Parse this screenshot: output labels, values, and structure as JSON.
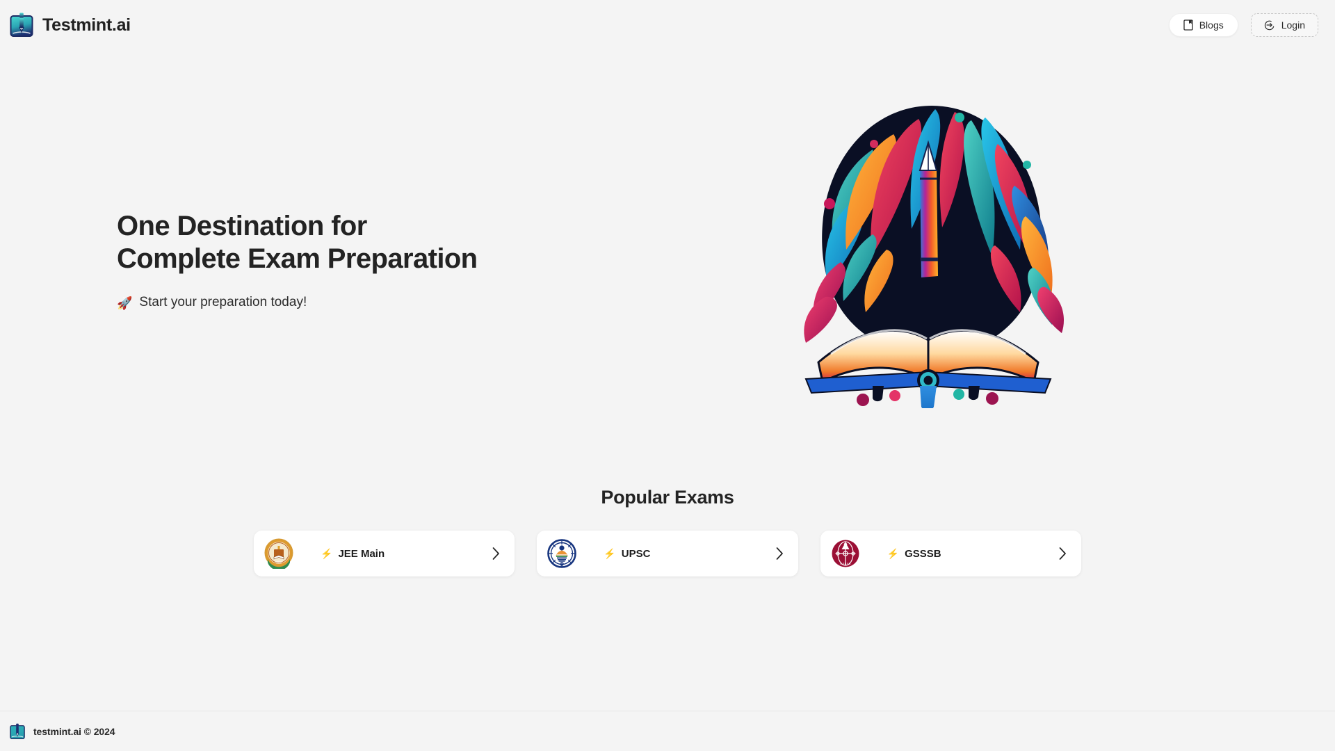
{
  "theme": {
    "background": "#f4f4f4",
    "card_background": "#ffffff",
    "text_primary": "#232323",
    "logo_gradient_from": "#3fd3cf",
    "logo_gradient_to": "#1b2b6b"
  },
  "header": {
    "brand_name": "Testmint.ai",
    "brand_logo_icon": "book-pen-icon",
    "blogs_button": {
      "label": "Blogs",
      "icon": "document-bookmark-icon"
    },
    "login_button": {
      "label": "Login",
      "icon": "login-arrow-circle-icon"
    }
  },
  "hero": {
    "title_line1": "One Destination for",
    "title_line2": "Complete Exam Preparation",
    "subtitle": "Start your preparation today!",
    "subtitle_emoji": "🚀",
    "illustration_name": "open-book-pencil-colorful-splash-illustration"
  },
  "popular_exams": {
    "heading": "Popular Exams",
    "bolt_emoji": "⚡",
    "chevron_icon": "chevron-right-icon",
    "cards": [
      {
        "name": "JEE Main",
        "logo_icon": "cbse-emblem-icon",
        "logo_colors": {
          "ring": "#e8a33d",
          "inner": "#f3e2c2",
          "banner": "#2e8b4f",
          "accent": "#b03a1a"
        }
      },
      {
        "name": "UPSC",
        "logo_icon": "upsc-emblem-icon",
        "logo_colors": {
          "ring": "#1a3f8f",
          "inner": "#ffffff",
          "banner": "#1a3f8f",
          "accent": "#e07b1f"
        }
      },
      {
        "name": "GSSSB",
        "logo_icon": "gsssb-emblem-icon",
        "logo_colors": {
          "ring": "#9b0f35",
          "inner": "#9b0f35",
          "banner": "#9b0f35",
          "accent": "#ffffff"
        }
      }
    ]
  },
  "footer": {
    "text": "testmint.ai © 2024",
    "logo_icon": "book-pen-icon"
  }
}
